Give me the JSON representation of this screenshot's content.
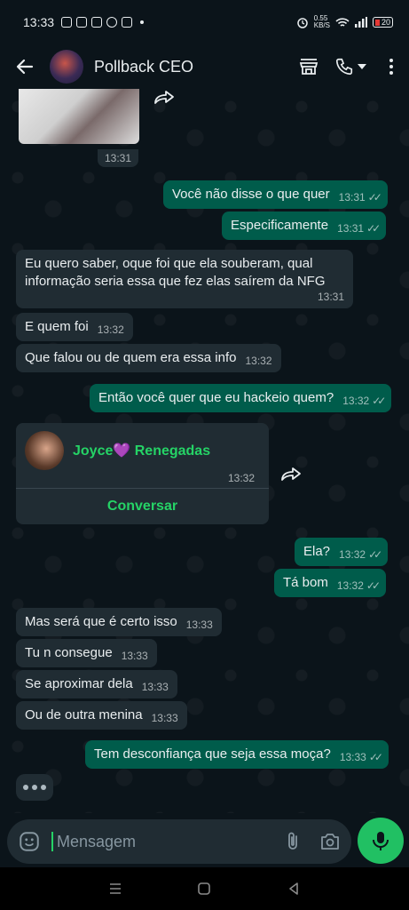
{
  "status_bar": {
    "time": "13:33",
    "net_speed": "0.55\nKB/S",
    "battery": "20"
  },
  "header": {
    "contact_name": "Pollback CEO"
  },
  "image_message": {
    "time": "13:31"
  },
  "messages": [
    {
      "text": "Você não disse o que quer",
      "time": "13:31"
    },
    {
      "text": "Especificamente",
      "time": "13:31"
    },
    {
      "text_line1": "Eu quero saber, oque foi que ela souberam, qual",
      "text_line2": "informação seria essa que fez elas saírem da NFG",
      "time": "13:31"
    },
    {
      "text": "E quem foi",
      "time": "13:32"
    },
    {
      "text": "Que falou ou de quem era essa info",
      "time": "13:32"
    },
    {
      "text": "Então você quer que eu hackeio quem?",
      "time": "13:32"
    },
    {
      "text": "Ela?",
      "time": "13:32"
    },
    {
      "text": "Tá bom",
      "time": "13:32"
    },
    {
      "text": "Mas será que é certo isso",
      "time": "13:33"
    },
    {
      "text": "Tu n consegue",
      "time": "13:33"
    },
    {
      "text": "Se aproximar dela",
      "time": "13:33"
    },
    {
      "text": "Ou de outra menina",
      "time": "13:33"
    },
    {
      "text": "Tem desconfiança que seja essa moça?",
      "time": "13:33"
    }
  ],
  "contact_card": {
    "name": "Joyce💜 Renegadas",
    "time": "13:32",
    "action": "Conversar"
  },
  "input": {
    "placeholder": "Mensagem"
  },
  "colors": {
    "accent": "#25d366",
    "outgoing": "#005c4b",
    "incoming": "#202c33",
    "background": "#0b141a"
  }
}
